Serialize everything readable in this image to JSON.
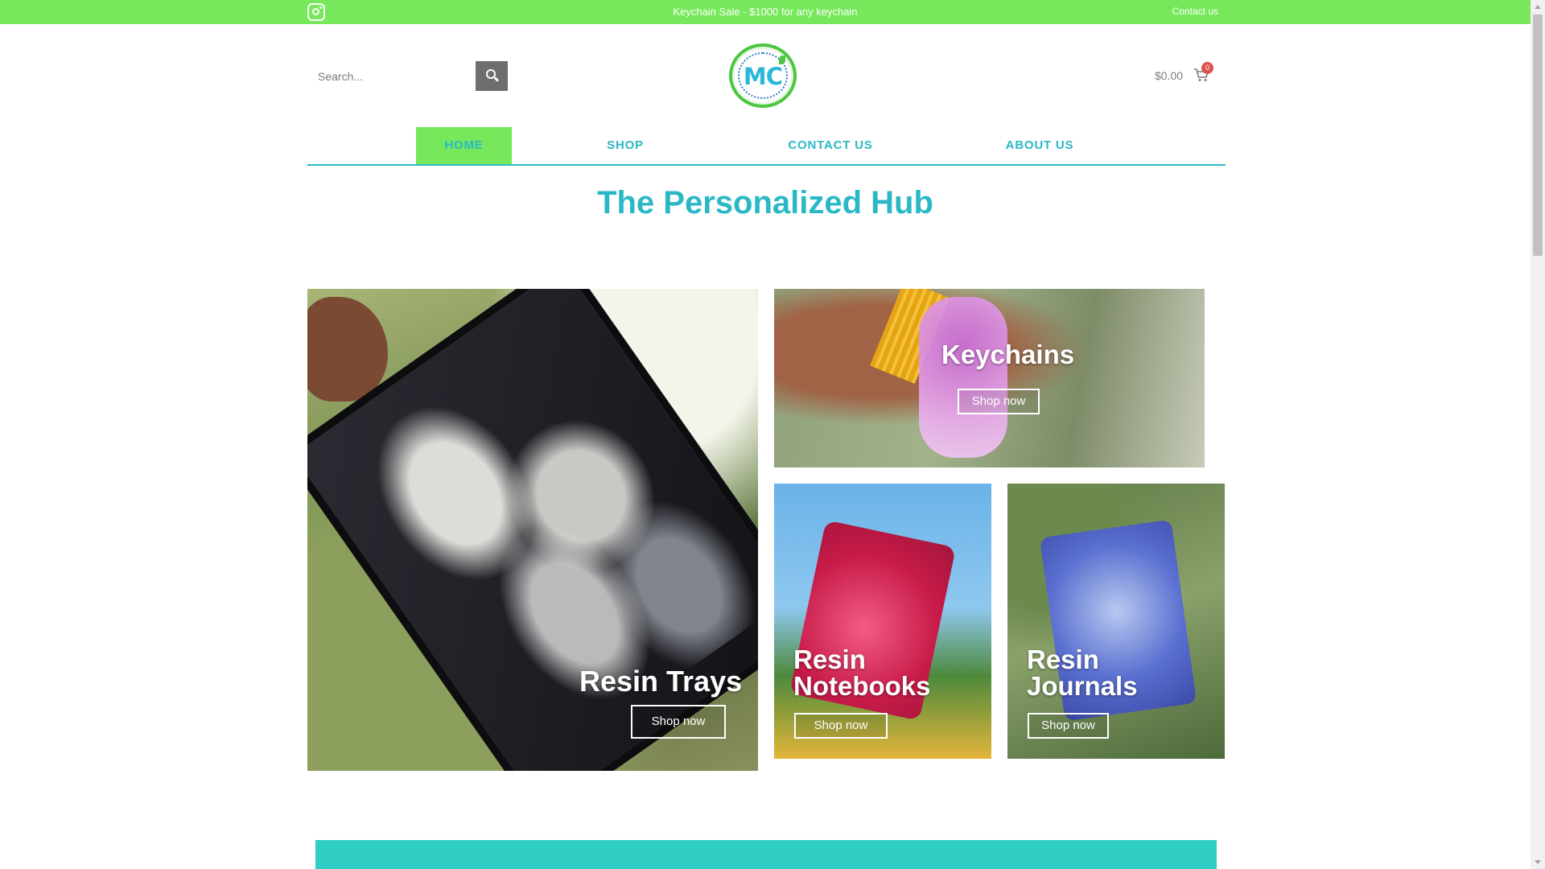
{
  "topbar": {
    "sale_text": "Keychain Sale - $1000 for any keychain",
    "contact_label": "Contact us",
    "icon": "instagram-icon",
    "color": "#77e85b"
  },
  "header": {
    "search_placeholder": "Search...",
    "search_icon": "search-icon",
    "logo_text": "MC",
    "cart_price": "$0.00",
    "cart_count": "0",
    "cart_icon": "cart-icon"
  },
  "nav": {
    "items": [
      {
        "label": "HOME",
        "active": true
      },
      {
        "label": "SHOP"
      },
      {
        "label": "CONTACT US"
      },
      {
        "label": "ABOUT US"
      }
    ],
    "accent": "#2bb8c6",
    "active_bg": "#77e85b"
  },
  "main": {
    "title": "The Personalized Hub",
    "tiles": [
      {
        "title": "Resin Trays",
        "button": "Shop now"
      },
      {
        "title": "Keychains",
        "button": "Shop now"
      },
      {
        "title": "Resin Notebooks",
        "button": "Shop now"
      },
      {
        "title": "Resin Journals",
        "button": "Shop now"
      }
    ]
  },
  "band": {
    "color": "#2fcfc6"
  }
}
